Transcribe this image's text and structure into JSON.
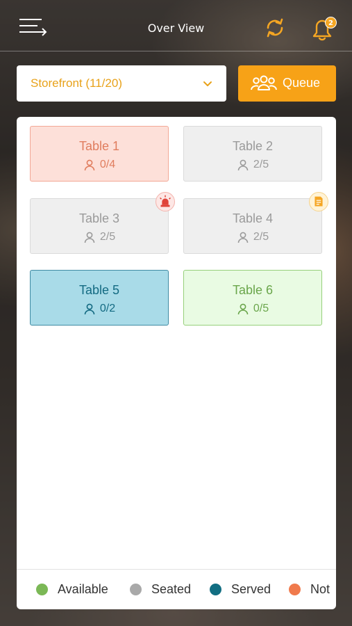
{
  "header": {
    "title": "Over View",
    "menu_icon": "menu-arrow-icon",
    "sync_icon": "sync-icon",
    "bell_icon": "bell-icon",
    "notification_count": "2",
    "accent_color": "#f5a623"
  },
  "section_select": {
    "value": "Storefront (11/20)",
    "icon": "chevron-down-icon"
  },
  "queue_button": {
    "label": "Queue",
    "icon": "group-icon",
    "color": "#f7a217"
  },
  "tables": [
    {
      "name": "Table 1",
      "seats": "0/4",
      "status": "not-available"
    },
    {
      "name": "Table 2",
      "seats": "2/5",
      "status": "seated"
    },
    {
      "name": "Table 3",
      "seats": "2/5",
      "status": "seated",
      "flag": "siren-icon"
    },
    {
      "name": "Table 4",
      "seats": "2/5",
      "status": "seated",
      "flag": "note-icon"
    },
    {
      "name": "Table 5",
      "seats": "0/2",
      "status": "served"
    },
    {
      "name": "Table 6",
      "seats": "0/5",
      "status": "available"
    }
  ],
  "status_colors": {
    "available": {
      "bg": "#e9fbe3",
      "border": "#96cf7a",
      "text": "#6aa64b"
    },
    "seated": {
      "bg": "#efefef",
      "border": "#dadada",
      "text": "#9a9a9a"
    },
    "served": {
      "bg": "#a9dbe8",
      "border": "#3e8aa3",
      "text": "#136a82"
    },
    "not-available": {
      "bg": "#fde0d9",
      "border": "#f3a896",
      "text": "#e07d5e"
    }
  },
  "legend": [
    {
      "label": "Available",
      "color": "#7bb856"
    },
    {
      "label": "Seated",
      "color": "#a9a9a9"
    },
    {
      "label": "Served",
      "color": "#126e82"
    },
    {
      "label": "Not",
      "color": "#f07a4c"
    }
  ]
}
